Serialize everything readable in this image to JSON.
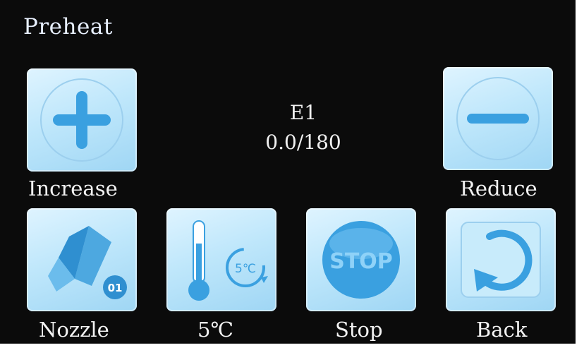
{
  "screen": {
    "title": "Preheat",
    "readout": {
      "extruder": "E1",
      "temperature": "0.0/180"
    }
  },
  "buttons": {
    "increase": {
      "label": "Increase",
      "icon": "plus-icon"
    },
    "reduce": {
      "label": "Reduce",
      "icon": "minus-icon"
    },
    "nozzle": {
      "label": "Nozzle",
      "icon": "nozzle-icon",
      "badge": "01"
    },
    "step": {
      "label": "5℃",
      "icon": "thermometer-icon",
      "badge": "5℃"
    },
    "stop": {
      "label": "Stop",
      "icon": "stop-icon",
      "badge": "STOP"
    },
    "back": {
      "label": "Back",
      "icon": "back-arrow-icon"
    }
  },
  "colors": {
    "background": "#0b0b0b",
    "button_light": "#dff4ff",
    "button_dark": "#9fd6f4",
    "icon_blue": "#3aa0e0"
  }
}
